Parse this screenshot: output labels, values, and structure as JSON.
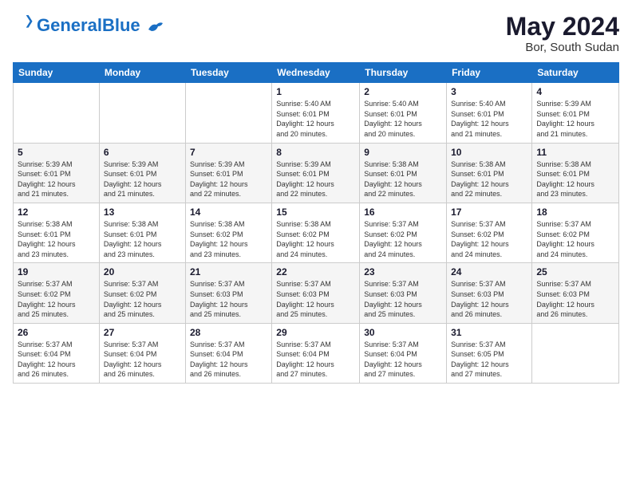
{
  "header": {
    "logo_line1": "General",
    "logo_line2": "Blue",
    "month_year": "May 2024",
    "location": "Bor, South Sudan"
  },
  "days_of_week": [
    "Sunday",
    "Monday",
    "Tuesday",
    "Wednesday",
    "Thursday",
    "Friday",
    "Saturday"
  ],
  "weeks": [
    [
      {
        "day": "",
        "info": ""
      },
      {
        "day": "",
        "info": ""
      },
      {
        "day": "",
        "info": ""
      },
      {
        "day": "1",
        "info": "Sunrise: 5:40 AM\nSunset: 6:01 PM\nDaylight: 12 hours\nand 20 minutes."
      },
      {
        "day": "2",
        "info": "Sunrise: 5:40 AM\nSunset: 6:01 PM\nDaylight: 12 hours\nand 20 minutes."
      },
      {
        "day": "3",
        "info": "Sunrise: 5:40 AM\nSunset: 6:01 PM\nDaylight: 12 hours\nand 21 minutes."
      },
      {
        "day": "4",
        "info": "Sunrise: 5:39 AM\nSunset: 6:01 PM\nDaylight: 12 hours\nand 21 minutes."
      }
    ],
    [
      {
        "day": "5",
        "info": "Sunrise: 5:39 AM\nSunset: 6:01 PM\nDaylight: 12 hours\nand 21 minutes."
      },
      {
        "day": "6",
        "info": "Sunrise: 5:39 AM\nSunset: 6:01 PM\nDaylight: 12 hours\nand 21 minutes."
      },
      {
        "day": "7",
        "info": "Sunrise: 5:39 AM\nSunset: 6:01 PM\nDaylight: 12 hours\nand 22 minutes."
      },
      {
        "day": "8",
        "info": "Sunrise: 5:39 AM\nSunset: 6:01 PM\nDaylight: 12 hours\nand 22 minutes."
      },
      {
        "day": "9",
        "info": "Sunrise: 5:38 AM\nSunset: 6:01 PM\nDaylight: 12 hours\nand 22 minutes."
      },
      {
        "day": "10",
        "info": "Sunrise: 5:38 AM\nSunset: 6:01 PM\nDaylight: 12 hours\nand 22 minutes."
      },
      {
        "day": "11",
        "info": "Sunrise: 5:38 AM\nSunset: 6:01 PM\nDaylight: 12 hours\nand 23 minutes."
      }
    ],
    [
      {
        "day": "12",
        "info": "Sunrise: 5:38 AM\nSunset: 6:01 PM\nDaylight: 12 hours\nand 23 minutes."
      },
      {
        "day": "13",
        "info": "Sunrise: 5:38 AM\nSunset: 6:01 PM\nDaylight: 12 hours\nand 23 minutes."
      },
      {
        "day": "14",
        "info": "Sunrise: 5:38 AM\nSunset: 6:02 PM\nDaylight: 12 hours\nand 23 minutes."
      },
      {
        "day": "15",
        "info": "Sunrise: 5:38 AM\nSunset: 6:02 PM\nDaylight: 12 hours\nand 24 minutes."
      },
      {
        "day": "16",
        "info": "Sunrise: 5:37 AM\nSunset: 6:02 PM\nDaylight: 12 hours\nand 24 minutes."
      },
      {
        "day": "17",
        "info": "Sunrise: 5:37 AM\nSunset: 6:02 PM\nDaylight: 12 hours\nand 24 minutes."
      },
      {
        "day": "18",
        "info": "Sunrise: 5:37 AM\nSunset: 6:02 PM\nDaylight: 12 hours\nand 24 minutes."
      }
    ],
    [
      {
        "day": "19",
        "info": "Sunrise: 5:37 AM\nSunset: 6:02 PM\nDaylight: 12 hours\nand 25 minutes."
      },
      {
        "day": "20",
        "info": "Sunrise: 5:37 AM\nSunset: 6:02 PM\nDaylight: 12 hours\nand 25 minutes."
      },
      {
        "day": "21",
        "info": "Sunrise: 5:37 AM\nSunset: 6:03 PM\nDaylight: 12 hours\nand 25 minutes."
      },
      {
        "day": "22",
        "info": "Sunrise: 5:37 AM\nSunset: 6:03 PM\nDaylight: 12 hours\nand 25 minutes."
      },
      {
        "day": "23",
        "info": "Sunrise: 5:37 AM\nSunset: 6:03 PM\nDaylight: 12 hours\nand 25 minutes."
      },
      {
        "day": "24",
        "info": "Sunrise: 5:37 AM\nSunset: 6:03 PM\nDaylight: 12 hours\nand 26 minutes."
      },
      {
        "day": "25",
        "info": "Sunrise: 5:37 AM\nSunset: 6:03 PM\nDaylight: 12 hours\nand 26 minutes."
      }
    ],
    [
      {
        "day": "26",
        "info": "Sunrise: 5:37 AM\nSunset: 6:04 PM\nDaylight: 12 hours\nand 26 minutes."
      },
      {
        "day": "27",
        "info": "Sunrise: 5:37 AM\nSunset: 6:04 PM\nDaylight: 12 hours\nand 26 minutes."
      },
      {
        "day": "28",
        "info": "Sunrise: 5:37 AM\nSunset: 6:04 PM\nDaylight: 12 hours\nand 26 minutes."
      },
      {
        "day": "29",
        "info": "Sunrise: 5:37 AM\nSunset: 6:04 PM\nDaylight: 12 hours\nand 27 minutes."
      },
      {
        "day": "30",
        "info": "Sunrise: 5:37 AM\nSunset: 6:04 PM\nDaylight: 12 hours\nand 27 minutes."
      },
      {
        "day": "31",
        "info": "Sunrise: 5:37 AM\nSunset: 6:05 PM\nDaylight: 12 hours\nand 27 minutes."
      },
      {
        "day": "",
        "info": ""
      }
    ]
  ]
}
